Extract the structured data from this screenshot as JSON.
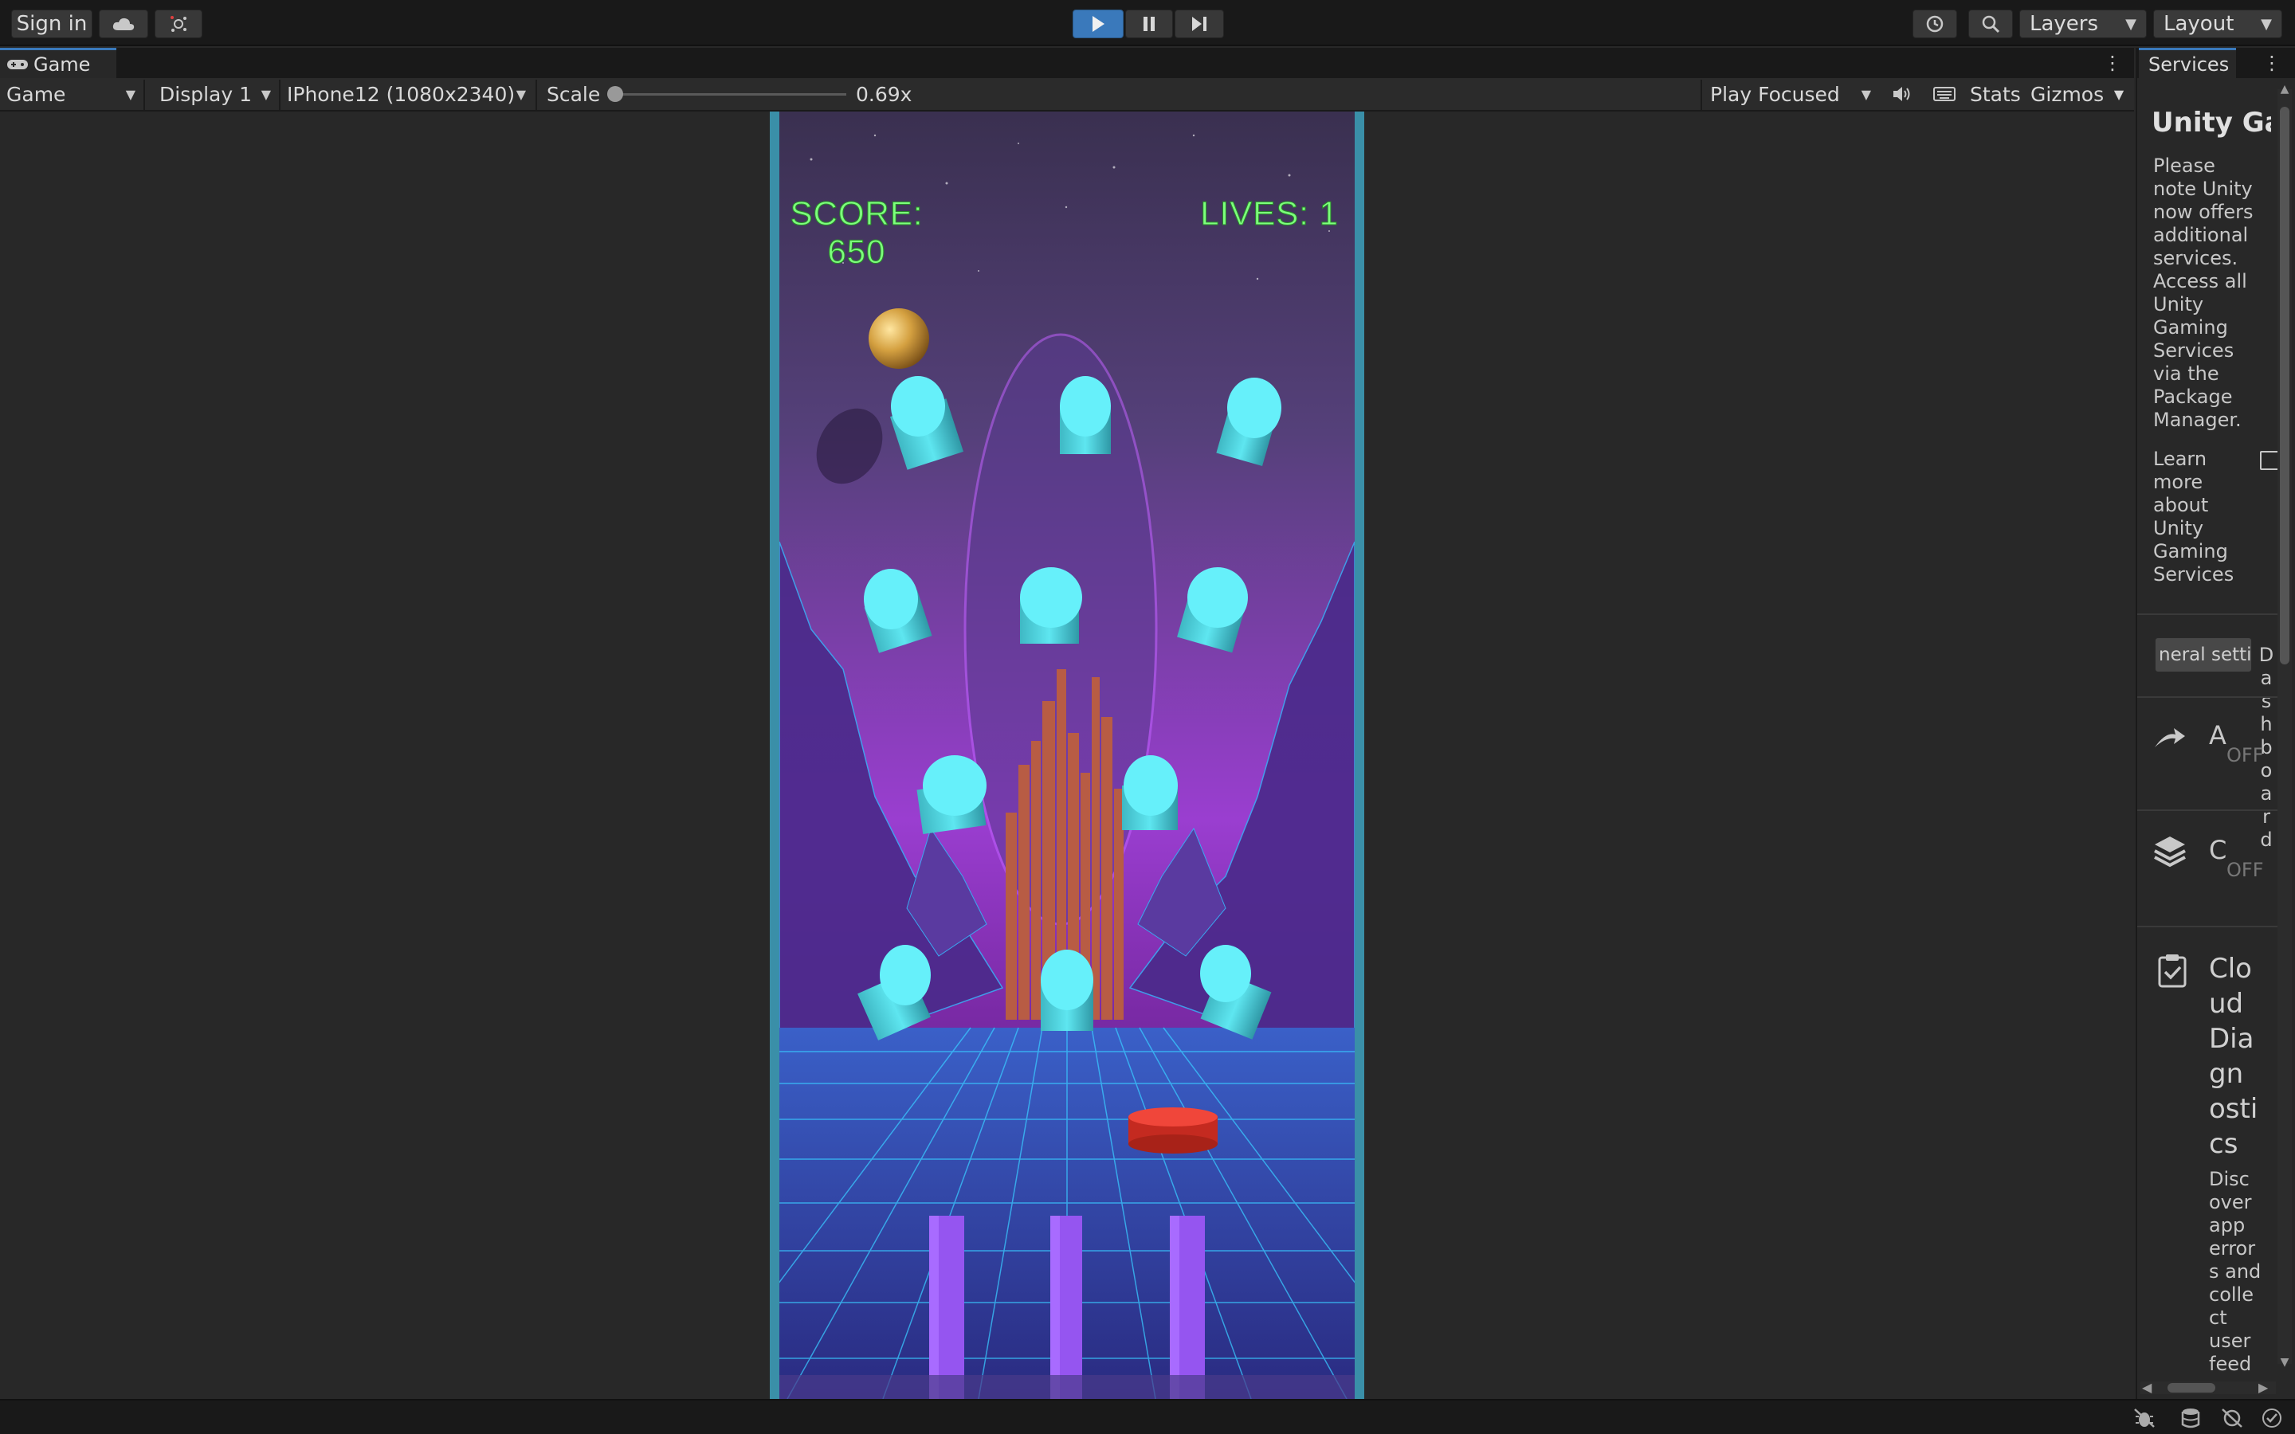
{
  "toolbar": {
    "sign_in_label": "Sign in",
    "cloud_icon": "cloud-icon",
    "collab_icon": "collab-icon",
    "play_icon": "play-icon",
    "pause_icon": "pause-icon",
    "step_icon": "step-icon",
    "history_icon": "history-icon",
    "search_icon": "search-icon",
    "layers_label": "Layers",
    "layout_label": "Layout"
  },
  "game_tab": {
    "label": "Game",
    "menu_icon": "kebab-menu-icon"
  },
  "game_toolbar": {
    "view_mode": "Game",
    "display": "Display 1",
    "resolution": "IPhone12 (1080x2340)",
    "scale_label": "Scale",
    "scale_value": "0.69x",
    "scale_fraction": 0.0,
    "play_mode": "Play Focused",
    "stats_label": "Stats",
    "gizmos_label": "Gizmos"
  },
  "game": {
    "score_label": "SCORE:",
    "score_value": "650",
    "lives_label": "LIVES: 1",
    "hud_color": "#7dff7d"
  },
  "services": {
    "tab_label": "Services",
    "title": "Unity Ga",
    "notice_lines": [
      "Please",
      "note Unity",
      "now offers",
      "additional",
      "services.",
      "Access all",
      "Unity",
      "Gaming",
      "Services",
      "via the",
      "Package",
      "Manager."
    ],
    "learn_lines": [
      "Learn",
      "more",
      "about",
      "Unity",
      "Gaming",
      "Services"
    ],
    "general_settings": "neral settin",
    "dashboard_letters": [
      "D",
      "a",
      "s",
      "h",
      "b",
      "o",
      "a",
      "r",
      "d"
    ],
    "ads_letter": "A",
    "ads_status": "OFF",
    "build_letter": "C",
    "build_status": "OFF",
    "diag_title_lines": [
      "Clo",
      "ud",
      "Dia",
      "gn",
      "osti",
      "cs"
    ],
    "diag_desc_lines": [
      "Disc",
      "over",
      "app",
      "error",
      "s and",
      "colle",
      "ct",
      "user",
      "feed"
    ]
  },
  "colors": {
    "accent": "#3a79bb",
    "play_active": "#3a79bb",
    "cylinder": "#5ee6f0",
    "ball": "#d4a040",
    "paddle": "#e0392d",
    "post": "#a86bff"
  }
}
